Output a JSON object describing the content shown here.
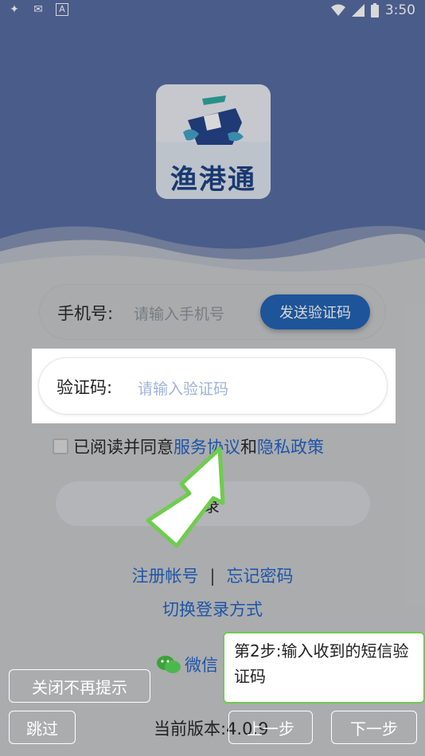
{
  "status_bar": {
    "time": "3:50",
    "left_icons": [
      "vpn-icon",
      "message-icon",
      "text-app-icon"
    ],
    "right_icons": [
      "wifi-icon",
      "signal-icon",
      "battery-icon"
    ]
  },
  "logo": {
    "text": "渔港通"
  },
  "form": {
    "phone_label": "手机号:",
    "phone_placeholder": "请输入手机号",
    "send_code_label": "发送验证码",
    "code_label": "验证码:",
    "code_placeholder": "请输入验证码",
    "agree_prefix": "已阅读并同意",
    "service_link": "服务协议",
    "agree_and": "和",
    "privacy_link": "隐私政策",
    "login_label": "录"
  },
  "links": {
    "register": "注册帐号",
    "separator": "|",
    "forgot": "忘记密码",
    "switch_login": "切换登录方式",
    "wechat": "微信"
  },
  "version_text": "当前版本:4.0.9",
  "guide": {
    "close_no_remind": "关闭不再提示",
    "skip": "跳过",
    "prev": "上一步",
    "next": "下一步",
    "tip_text": "第2步:输入收到的短信验证码"
  },
  "colors": {
    "hero_blue": "#5268a0",
    "link_blue": "#1d55a8",
    "send_button": "#1d5fb3",
    "tip_border": "#6fcc4e"
  }
}
